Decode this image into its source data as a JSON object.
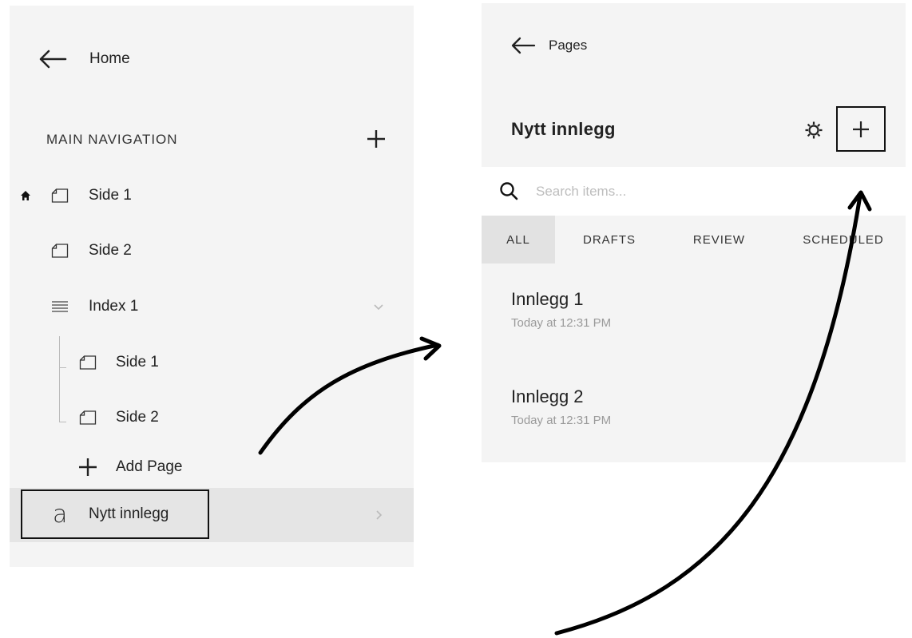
{
  "left": {
    "back_label": "Home",
    "section_title": "MAIN NAVIGATION",
    "items": [
      {
        "label": "Side 1",
        "is_home": true
      },
      {
        "label": "Side 2"
      },
      {
        "label": "Index 1"
      },
      {
        "label": "Side 1"
      },
      {
        "label": "Side 2"
      }
    ],
    "add_page_label": "Add Page",
    "selected_label": "Nytt innlegg",
    "selected_icon": "a"
  },
  "right": {
    "back_label": "Pages",
    "title": "Nytt innlegg",
    "search_placeholder": "Search items...",
    "tabs": [
      "ALL",
      "DRAFTS",
      "REVIEW",
      "SCHEDULED"
    ],
    "active_tab": "ALL",
    "posts": [
      {
        "title": "Innlegg 1",
        "time": "Today at 12:31 PM"
      },
      {
        "title": "Innlegg 2",
        "time": "Today at 12:31 PM"
      }
    ]
  },
  "colors": {
    "panel_bg": "#f4f4f4",
    "selected_bg": "#e5e5e5",
    "tab_active_bg": "#e2e2e2",
    "outline": "#111111",
    "muted_text": "#9a9a9a"
  }
}
